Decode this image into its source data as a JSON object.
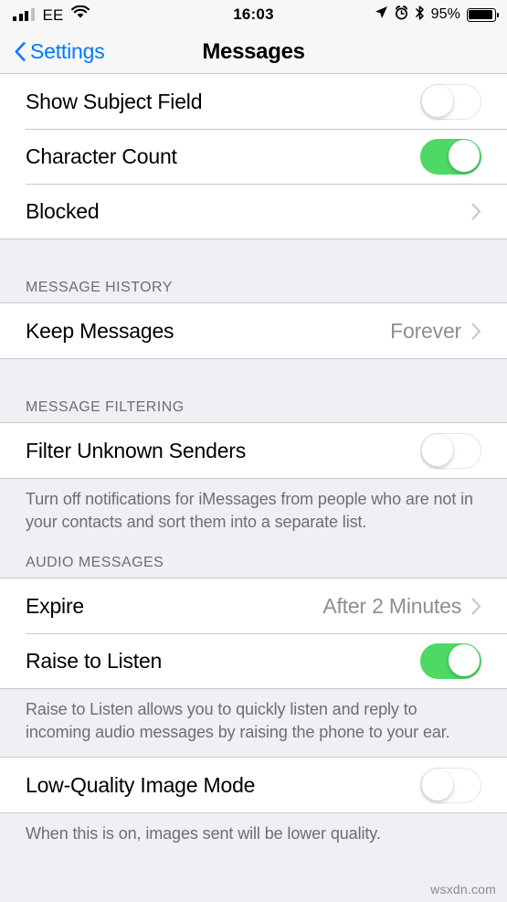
{
  "status_bar": {
    "carrier": "EE",
    "signal_bars_filled": 3,
    "signal_bars_total": 4,
    "wifi_icon": "wifi-icon",
    "time": "16:03",
    "location_icon": "location-arrow-icon",
    "alarm_icon": "alarm-clock-icon",
    "bluetooth_icon": "bluetooth-icon",
    "battery_percent": "95%",
    "battery_icon": "battery-icon"
  },
  "nav_bar": {
    "back_label": "Settings",
    "back_icon": "chevron-left-icon",
    "title": "Messages",
    "tint_color": "#007AFF"
  },
  "colors": {
    "background": "#EFEFF4",
    "cell": "#FFFFFF",
    "separator": "#C8C7CC",
    "switch_on": "#4CD964",
    "secondary_text": "#8E8E93",
    "header_text": "#6D6D72"
  },
  "sections": [
    {
      "header": "",
      "footer": "",
      "rows": [
        {
          "label": "Show Subject Field",
          "type": "switch",
          "value": "off"
        },
        {
          "label": "Character Count",
          "type": "switch",
          "value": "on"
        },
        {
          "label": "Blocked",
          "type": "disclosure",
          "value": ""
        }
      ]
    },
    {
      "header": "MESSAGE HISTORY",
      "footer": "",
      "rows": [
        {
          "label": "Keep Messages",
          "type": "disclosure",
          "value": "Forever"
        }
      ]
    },
    {
      "header": "MESSAGE FILTERING",
      "footer": "Turn off notifications for iMessages from people who are not in your contacts and sort them into a separate list.",
      "rows": [
        {
          "label": "Filter Unknown Senders",
          "type": "switch",
          "value": "off"
        }
      ]
    },
    {
      "header": "AUDIO MESSAGES",
      "footer": "Raise to Listen allows you to quickly listen and reply to incoming audio messages by raising the phone to your ear.",
      "rows": [
        {
          "label": "Expire",
          "type": "disclosure",
          "value": "After 2 Minutes"
        },
        {
          "label": "Raise to Listen",
          "type": "switch",
          "value": "on"
        }
      ]
    },
    {
      "header": "",
      "footer": "When this is on, images sent will be lower quality.",
      "rows": [
        {
          "label": "Low-Quality Image Mode",
          "type": "switch",
          "value": "off"
        }
      ]
    }
  ],
  "watermark": "wsxdn.com"
}
